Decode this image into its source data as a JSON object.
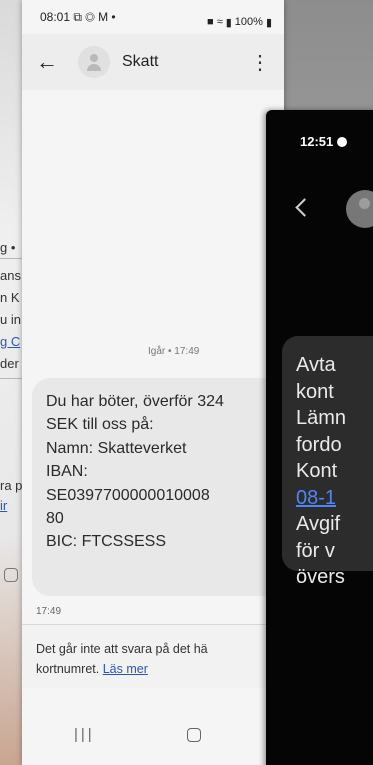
{
  "background_phone": {
    "fragments": [
      "g •",
      "ans",
      "n K",
      "u in",
      "g C",
      "der",
      "ra p",
      "ir"
    ]
  },
  "phone_left": {
    "status_bar": {
      "time": "08:01",
      "notif_icons": "⧉ ◎ M •",
      "battery": "100%"
    },
    "header": {
      "back_icon": "arrow-back-icon",
      "contact_name": "Skatt",
      "menu_icon": "more-vertical-icon"
    },
    "message_timestamp": "Igår • 17:49",
    "message_lines": [
      "Du har böter, överför 324",
      "SEK till oss på:",
      "Namn: Skatteverket",
      "IBAN:",
      "SE0397700000010008",
      "80",
      "BIC: FTCSSESS"
    ],
    "message_time": "17:49",
    "reply_note": {
      "text": "Det går inte att svara på det hä",
      "text2": "kortnumret.",
      "link": "Läs mer"
    },
    "nav": {
      "recents": "|||"
    }
  },
  "phone_right": {
    "status_time": "12:51",
    "message_lines": [
      "Avta",
      "kont",
      "Lämn",
      "fordo",
      "Kont",
      "08-1",
      "Avgif",
      "för v",
      "övers"
    ]
  },
  "colors": {
    "link": "#2b56b3",
    "bubble_light": "#e8e8e8",
    "bubble_dark": "#2c2c2c",
    "dark_link": "#4f86f7"
  }
}
